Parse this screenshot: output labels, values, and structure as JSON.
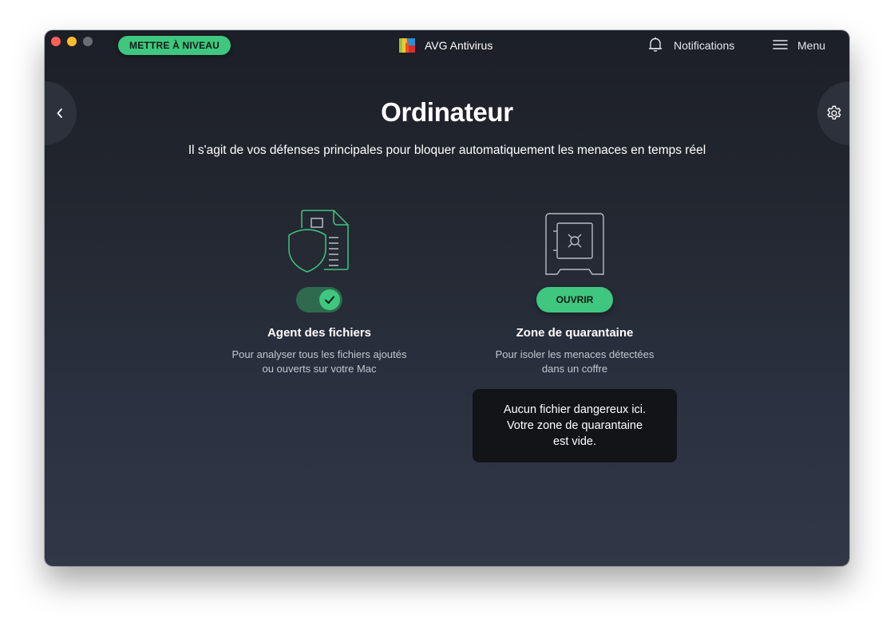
{
  "window": {
    "traffic_lights": [
      "close",
      "minimize",
      "maximize"
    ]
  },
  "header": {
    "upgrade_label": "METTRE À NIVEAU",
    "app_name": "AVG Antivirus",
    "notifications_label": "Notifications",
    "menu_label": "Menu"
  },
  "nav": {
    "back_icon": "chevron-left-icon",
    "settings_icon": "gear-icon"
  },
  "main": {
    "title": "Ordinateur",
    "subtitle": "Il s'agit de vos défenses principales pour bloquer automatiquement les menaces en temps réel"
  },
  "cards": [
    {
      "icon": "shield-document-icon",
      "control": "toggle",
      "toggle_on": true,
      "title": "Agent des fichiers",
      "desc_line1": "Pour analyser tous les fichiers ajoutés",
      "desc_line2": "ou ouverts sur votre Mac"
    },
    {
      "icon": "safe-vault-icon",
      "control": "button",
      "button_label": "OUVRIR",
      "title": "Zone de quarantaine",
      "desc_line1": "Pour isoler les menaces détectées",
      "desc_line2": "dans un coffre"
    }
  ],
  "tooltip": {
    "line1": "Aucun fichier dangereux ici.",
    "line2": "Votre zone de quarantaine",
    "line3": "est vide."
  },
  "colors": {
    "accent": "#3fc67f",
    "toggle_track": "#2f6a4e",
    "icon_green": "#3fc67f",
    "icon_gray": "#b8bcc6",
    "tooltip_bg": "#121418"
  }
}
